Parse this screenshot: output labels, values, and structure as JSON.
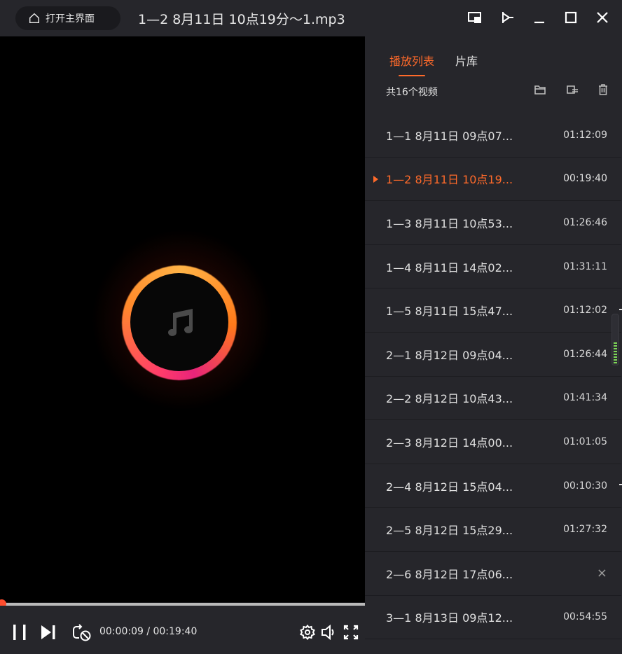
{
  "titlebar": {
    "home_label": "打开主界面",
    "title": "1—2   8月11日 10点19分～1.mp3",
    "buttons": [
      "screen-icon",
      "pin-icon",
      "minimize-icon",
      "maximize-icon",
      "close-icon"
    ]
  },
  "player": {
    "current_time": "00:00:09",
    "total_time": "00:19:40",
    "time_display": "00:00:09 / 00:19:40",
    "progress": 0.008,
    "accent": "#ff5a3c"
  },
  "panel": {
    "tabs": [
      {
        "label": "播放列表",
        "active": true
      },
      {
        "label": "片库",
        "active": false
      }
    ],
    "count_label": "共16个视频",
    "items": [
      {
        "name": "1—1   8月11日 09点07...",
        "duration": "01:12:09"
      },
      {
        "name": "1—2   8月11日 10点19...",
        "duration": "00:19:40",
        "active": true
      },
      {
        "name": "1—3   8月11日 10点53...",
        "duration": "01:26:46"
      },
      {
        "name": "1—4   8月11日 14点02...",
        "duration": "01:31:11"
      },
      {
        "name": "1—5   8月11日 15点47...",
        "duration": "01:12:02"
      },
      {
        "name": "2—1   8月12日 09点04...",
        "duration": "01:26:44"
      },
      {
        "name": "2—2   8月12日 10点43...",
        "duration": "01:41:34"
      },
      {
        "name": "2—3   8月12日 14点00...",
        "duration": "01:01:05"
      },
      {
        "name": "2—4  8月12日 15点04...",
        "duration": "00:10:30"
      },
      {
        "name": "2—5   8月12日 15点29...",
        "duration": "01:27:32"
      },
      {
        "name": "2—6   8月12日 17点06...",
        "duration": "×"
      },
      {
        "name": "3—1   8月13日 09点12...",
        "duration": "00:54:55"
      }
    ]
  },
  "colors": {
    "accent": "#ff6a2a",
    "panel_bg": "#26262b",
    "video_bg": "#000000"
  }
}
